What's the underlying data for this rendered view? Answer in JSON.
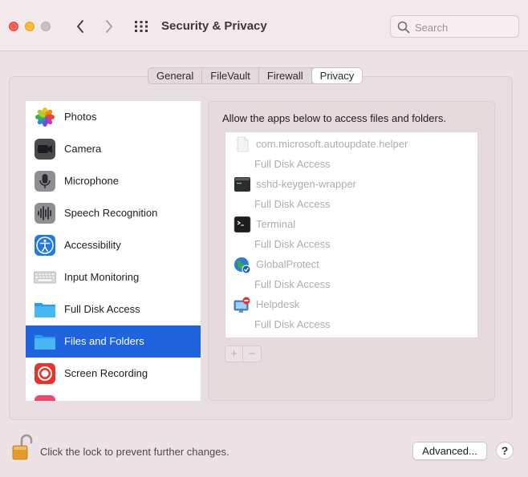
{
  "window": {
    "title": "Security & Privacy"
  },
  "search": {
    "placeholder": "Search"
  },
  "tabs": [
    {
      "label": "General"
    },
    {
      "label": "FileVault"
    },
    {
      "label": "Firewall"
    },
    {
      "label": "Privacy"
    }
  ],
  "active_tab": "Privacy",
  "sidebar": {
    "items": [
      {
        "label": "Photos",
        "icon": "photos-icon"
      },
      {
        "label": "Camera",
        "icon": "camera-icon"
      },
      {
        "label": "Microphone",
        "icon": "microphone-icon"
      },
      {
        "label": "Speech Recognition",
        "icon": "speech-recognition-icon"
      },
      {
        "label": "Accessibility",
        "icon": "accessibility-icon"
      },
      {
        "label": "Input Monitoring",
        "icon": "keyboard-icon"
      },
      {
        "label": "Full Disk Access",
        "icon": "folder-icon"
      },
      {
        "label": "Files and Folders",
        "icon": "folder-icon"
      },
      {
        "label": "Screen Recording",
        "icon": "screen-recording-icon"
      }
    ],
    "selected": "Files and Folders"
  },
  "panel": {
    "header": "Allow the apps below to access files and folders.",
    "apps": [
      {
        "name": "com.microsoft.autoupdate.helper",
        "access": "Full Disk Access",
        "icon": "blank-document-icon"
      },
      {
        "name": "sshd-keygen-wrapper",
        "access": "Full Disk Access",
        "icon": "terminal-icon"
      },
      {
        "name": "Terminal",
        "access": "Full Disk Access",
        "icon": "terminal-icon"
      },
      {
        "name": "GlobalProtect",
        "access": "Full Disk Access",
        "icon": "globe-icon"
      },
      {
        "name": "Helpdesk",
        "access": "Full Disk Access",
        "icon": "helpdesk-icon"
      }
    ],
    "add_label": "+",
    "remove_label": "−"
  },
  "footer": {
    "lock_text": "Click the lock to prevent further changes.",
    "advanced_label": "Advanced...",
    "help_label": "?"
  },
  "colors": {
    "selection": "#1f63dd",
    "close": "#ff5f57",
    "minimize": "#febc2e"
  }
}
